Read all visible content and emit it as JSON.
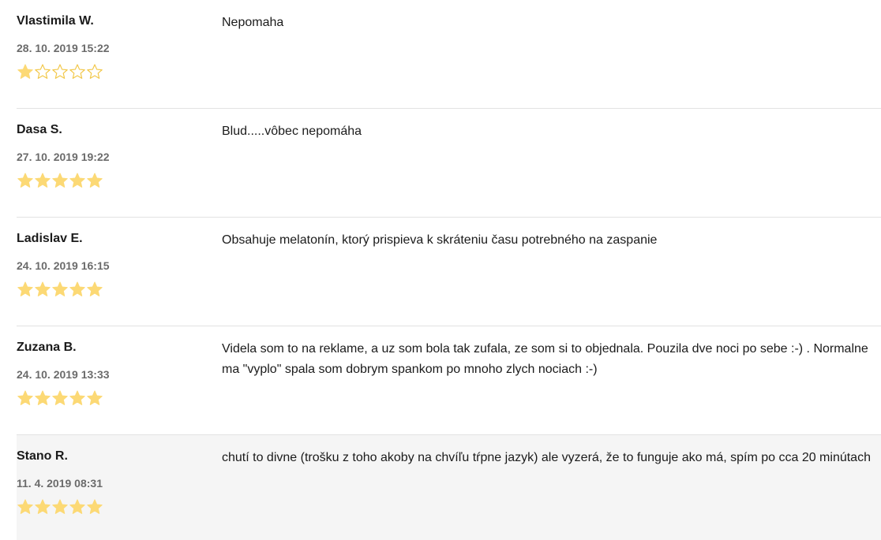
{
  "colors": {
    "star_filled": "#fcd975",
    "star_outline": "#f2c84b",
    "highlight_row": "#f5f5f5",
    "divider": "#e2e2e2"
  },
  "reviews": [
    {
      "author": "Vlastimila W.",
      "date": "28. 10. 2019 15:22",
      "rating": 1,
      "max_rating": 5,
      "text": "Nepomaha"
    },
    {
      "author": "Dasa S.",
      "date": "27. 10. 2019 19:22",
      "rating": 5,
      "max_rating": 5,
      "text": "Blud.....vôbec nepomáha"
    },
    {
      "author": "Ladislav E.",
      "date": "24. 10. 2019 16:15",
      "rating": 5,
      "max_rating": 5,
      "text": "Obsahuje melatonín, ktorý prispieva k skráteniu času potrebného na zaspanie"
    },
    {
      "author": "Zuzana B.",
      "date": "24. 10. 2019 13:33",
      "rating": 5,
      "max_rating": 5,
      "text": "Videla som to na reklame, a uz som bola tak zufala, ze som si to objednala. Pouzila dve noci po sebe :-) . Normalne ma \"vyplo\" spala som dobrym spankom po mnoho zlych nociach :-)"
    },
    {
      "author": "Stano R.",
      "date": "11. 4. 2019 08:31",
      "rating": 5,
      "max_rating": 5,
      "text": "chutí to divne (trošku z toho akoby na chvíľu tŕpne jazyk) ale vyzerá, že to funguje ako má, spím po cca 20 minútach"
    }
  ]
}
